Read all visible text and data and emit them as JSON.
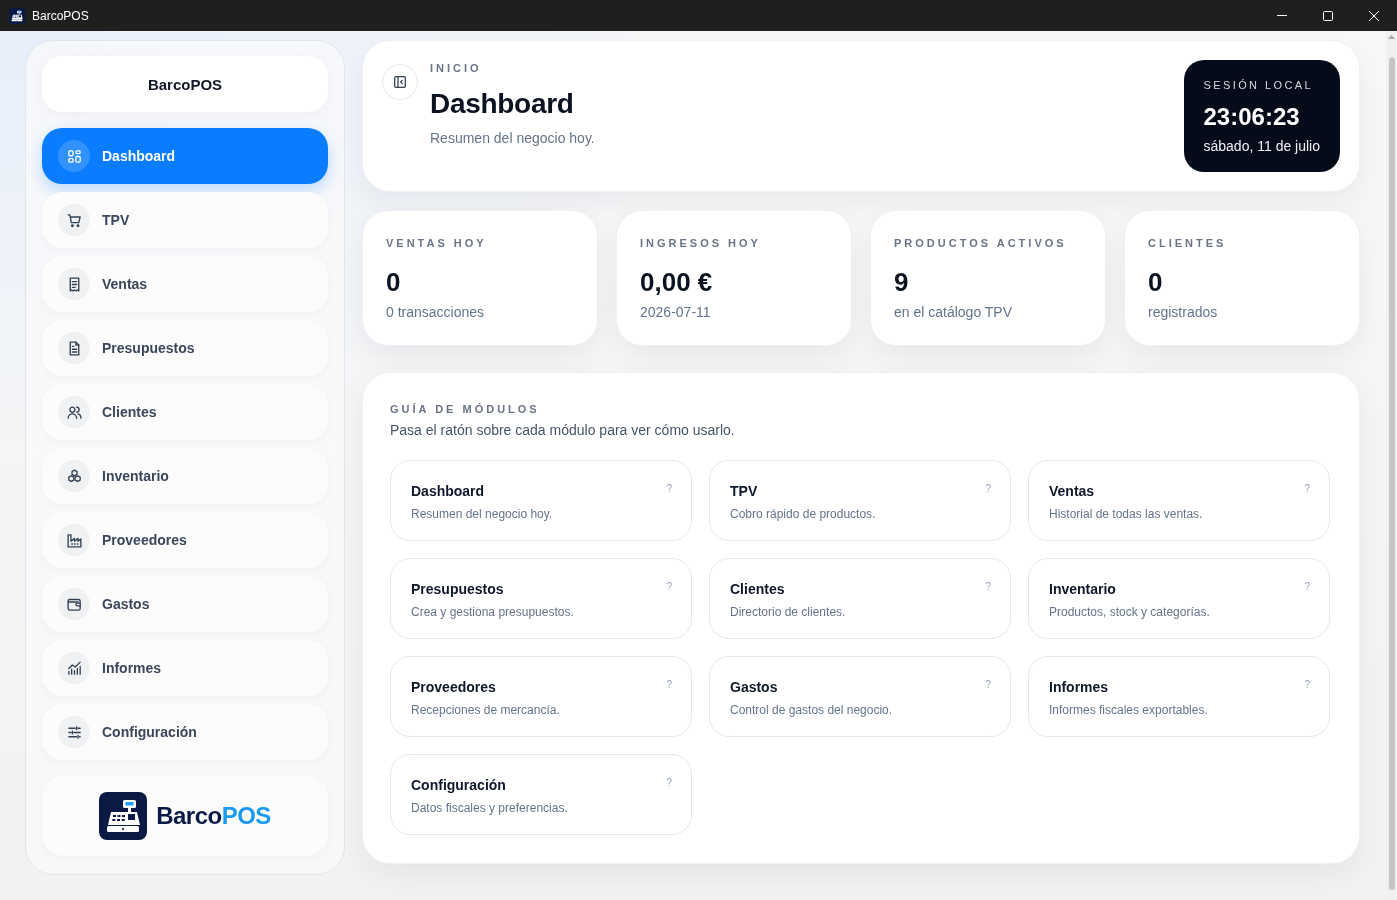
{
  "window": {
    "title": "BarcoPOS"
  },
  "sidebar": {
    "brand": "BarcoPOS",
    "items": [
      {
        "label": "Dashboard",
        "selected": true
      },
      {
        "label": "TPV",
        "selected": false
      },
      {
        "label": "Ventas",
        "selected": false
      },
      {
        "label": "Presupuestos",
        "selected": false
      },
      {
        "label": "Clientes",
        "selected": false
      },
      {
        "label": "Inventario",
        "selected": false
      },
      {
        "label": "Proveedores",
        "selected": false
      },
      {
        "label": "Gastos",
        "selected": false
      },
      {
        "label": "Informes",
        "selected": false
      },
      {
        "label": "Configuración",
        "selected": false
      }
    ],
    "logo": {
      "wordmark": "Barco",
      "wordmark_accent": "POS"
    }
  },
  "header": {
    "eyebrow": "INICIO",
    "title": "Dashboard",
    "subtitle": "Resumen del negocio hoy.",
    "session": {
      "label": "SESIÓN LOCAL",
      "time": "23:06:23",
      "date": "sábado, 11 de julio"
    }
  },
  "stats": [
    {
      "label": "VENTAS HOY",
      "value": "0",
      "note": "0 transacciones"
    },
    {
      "label": "INGRESOS HOY",
      "value": "0,00 €",
      "note": "2026-07-11"
    },
    {
      "label": "PRODUCTOS ACTIVOS",
      "value": "9",
      "note": "en el catálogo TPV"
    },
    {
      "label": "CLIENTES",
      "value": "0",
      "note": "registrados"
    }
  ],
  "guide": {
    "title": "GUÍA DE MÓDULOS",
    "subtitle": "Pasa el ratón sobre cada módulo para ver cómo usarlo.",
    "modules": [
      {
        "title": "Dashboard",
        "description": "Resumen del negocio hoy.",
        "help": "?"
      },
      {
        "title": "TPV",
        "description": "Cobro rápido de productos.",
        "help": "?"
      },
      {
        "title": "Ventas",
        "description": "Historial de todas las ventas.",
        "help": "?"
      },
      {
        "title": "Presupuestos",
        "description": "Crea y gestiona presupuestos.",
        "help": "?"
      },
      {
        "title": "Clientes",
        "description": "Directorio de clientes.",
        "help": "?"
      },
      {
        "title": "Inventario",
        "description": "Productos, stock y categorías.",
        "help": "?"
      },
      {
        "title": "Proveedores",
        "description": "Recepciones de mercancía.",
        "help": "?"
      },
      {
        "title": "Gastos",
        "description": "Control de gastos del negocio.",
        "help": "?"
      },
      {
        "title": "Informes",
        "description": "Informes fiscales exportables.",
        "help": "?"
      },
      {
        "title": "Configuración",
        "description": "Datos fiscales y preferencias.",
        "help": "?"
      }
    ]
  }
}
